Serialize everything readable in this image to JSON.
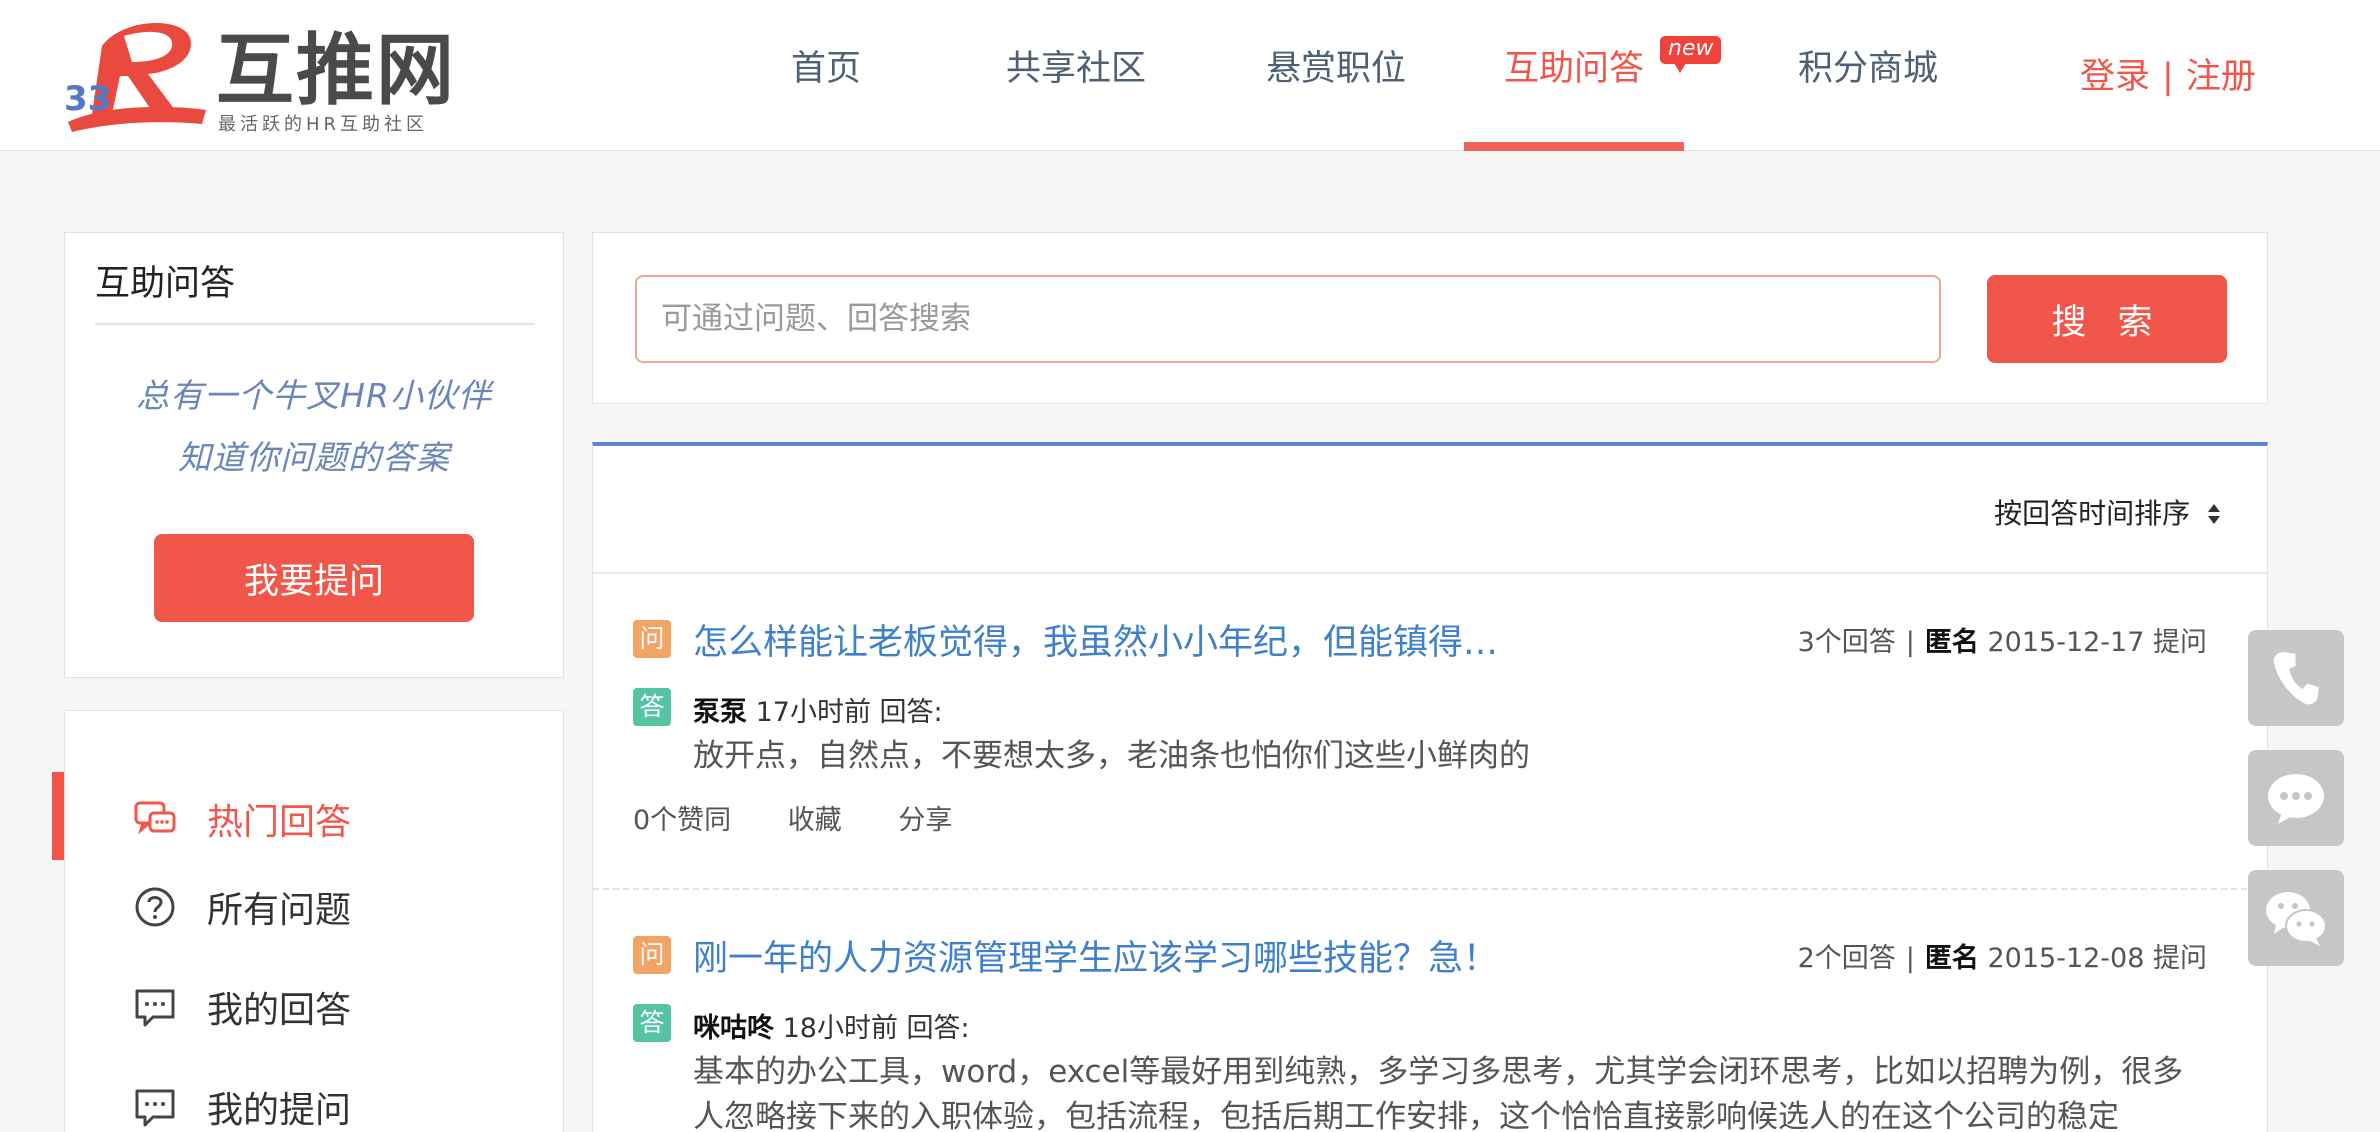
{
  "header": {
    "logo_text": "互推网",
    "logo_sub": "最活跃的HR互助社区",
    "nav": [
      {
        "label": "首页"
      },
      {
        "label": "共享社区"
      },
      {
        "label": "悬赏职位"
      },
      {
        "label": "互助问答",
        "active": true,
        "badge": "new"
      },
      {
        "label": "积分商城"
      }
    ],
    "login_label": "登录",
    "auth_sep": "|",
    "register_label": "注册"
  },
  "sidebar": {
    "title": "互助问答",
    "slogan_line1": "总有一个牛叉HR小伙伴",
    "slogan_line2": "知道你问题的答案",
    "ask_button": "我要提问",
    "menu": [
      {
        "label": "热门回答",
        "icon": "chat-bubbles-icon",
        "active": true
      },
      {
        "label": "所有问题",
        "icon": "question-circle-icon"
      },
      {
        "label": "我的回答",
        "icon": "message-dots-icon"
      },
      {
        "label": "我的提问",
        "icon": "message-dots-icon"
      }
    ]
  },
  "search": {
    "placeholder": "可通过问题、回答搜索",
    "button": "搜 索"
  },
  "list": {
    "sort_label": "按回答时间排序",
    "question_tag": "问",
    "answer_tag": "答",
    "items": [
      {
        "title": "怎么样能让老板觉得，我虽然小小年纪，但能镇得…",
        "answers": "3个回答",
        "sep": "|",
        "asker": "匿名",
        "date": "2015-12-17 提问",
        "answer_user": "泵泵",
        "answer_time": "17小时前 回答:",
        "answer_text": "放开点，自然点，不要想太多，老油条也怕你们这些小鲜肉的",
        "likes": "0个赞同",
        "favorite": "收藏",
        "share": "分享"
      },
      {
        "title": "刚一年的人力资源管理学生应该学习哪些技能？急！",
        "answers": "2个回答",
        "sep": "|",
        "asker": "匿名",
        "date": "2015-12-08 提问",
        "answer_user": "咪咕咚",
        "answer_time": "18小时前 回答:",
        "answer_text": "基本的办公工具，word，excel等最好用到纯熟，多学习多思考，尤其学会闭环思考，比如以招聘为例，很多人忽略接下来的入职体验，包括流程，包括后期工作安排，这个恰恰直接影响候选人的在这个公司的稳定"
      }
    ]
  },
  "floating": [
    {
      "icon": "phone-icon"
    },
    {
      "icon": "chat-icon"
    },
    {
      "icon": "wechat-icon"
    }
  ],
  "colors": {
    "accent": "#f0564a",
    "link": "#3f80cc",
    "nav_text": "#4d6076",
    "slogan": "#6a86b8",
    "question_tag": "#f1a565",
    "answer_tag": "#54c4a4",
    "list_top_border": "#5d83d1"
  }
}
